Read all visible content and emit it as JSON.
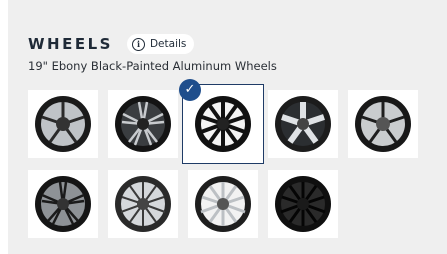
{
  "header": {
    "title": "WHEELS",
    "details_label": "Details",
    "details_icon": "info-icon"
  },
  "selected_option": "19\" Ebony Black-Painted Aluminum Wheels",
  "wheels": [
    {
      "id": "w1",
      "style": "chrome-split-spoke",
      "selected": false
    },
    {
      "id": "w2",
      "style": "black-machined-split",
      "selected": false
    },
    {
      "id": "w3",
      "style": "ebony-black-painted",
      "selected": true
    },
    {
      "id": "w4",
      "style": "bright-five-spoke",
      "selected": false
    },
    {
      "id": "w5",
      "style": "gloss-twin-spoke",
      "selected": false
    },
    {
      "id": "w6",
      "style": "dark-multi-spoke",
      "selected": false
    },
    {
      "id": "w7",
      "style": "polished-multi-spoke",
      "selected": false
    },
    {
      "id": "w8",
      "style": "silver-ten-spoke",
      "selected": false
    },
    {
      "id": "w9",
      "style": "black-mesh",
      "selected": false
    }
  ],
  "colors": {
    "accent": "#1f4e8c",
    "panel": "#efefef"
  }
}
